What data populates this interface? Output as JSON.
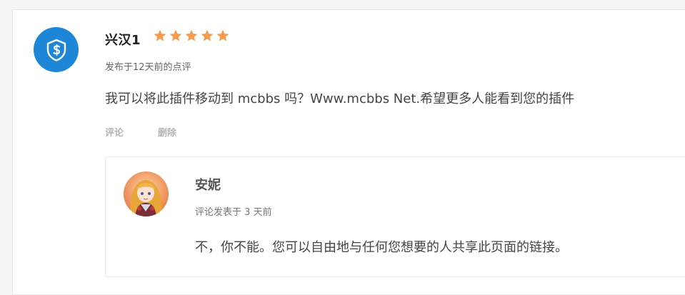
{
  "review": {
    "author": "兴汉1",
    "rating": 5,
    "rating_max": 5,
    "posted_meta": "发布于12天前的点评",
    "text": "我可以将此插件移动到 mcbbs 吗？Www.mcbbs Net.希望更多人能看到您的插件",
    "actions": {
      "reply_label": "评论",
      "delete_label": "删除"
    },
    "avatar_icon": "shield-s-icon"
  },
  "reply": {
    "author": "安妮",
    "meta": "评论发表于 3 天前",
    "text": "不，你不能。您可以自由地与任何您想要的人共享此页面的链接。",
    "avatar_icon": "anime-character-avatar"
  },
  "colors": {
    "star": "#f59a4f",
    "avatar_main_bg": "#1e86d6",
    "action_text": "#b5b5b5"
  }
}
